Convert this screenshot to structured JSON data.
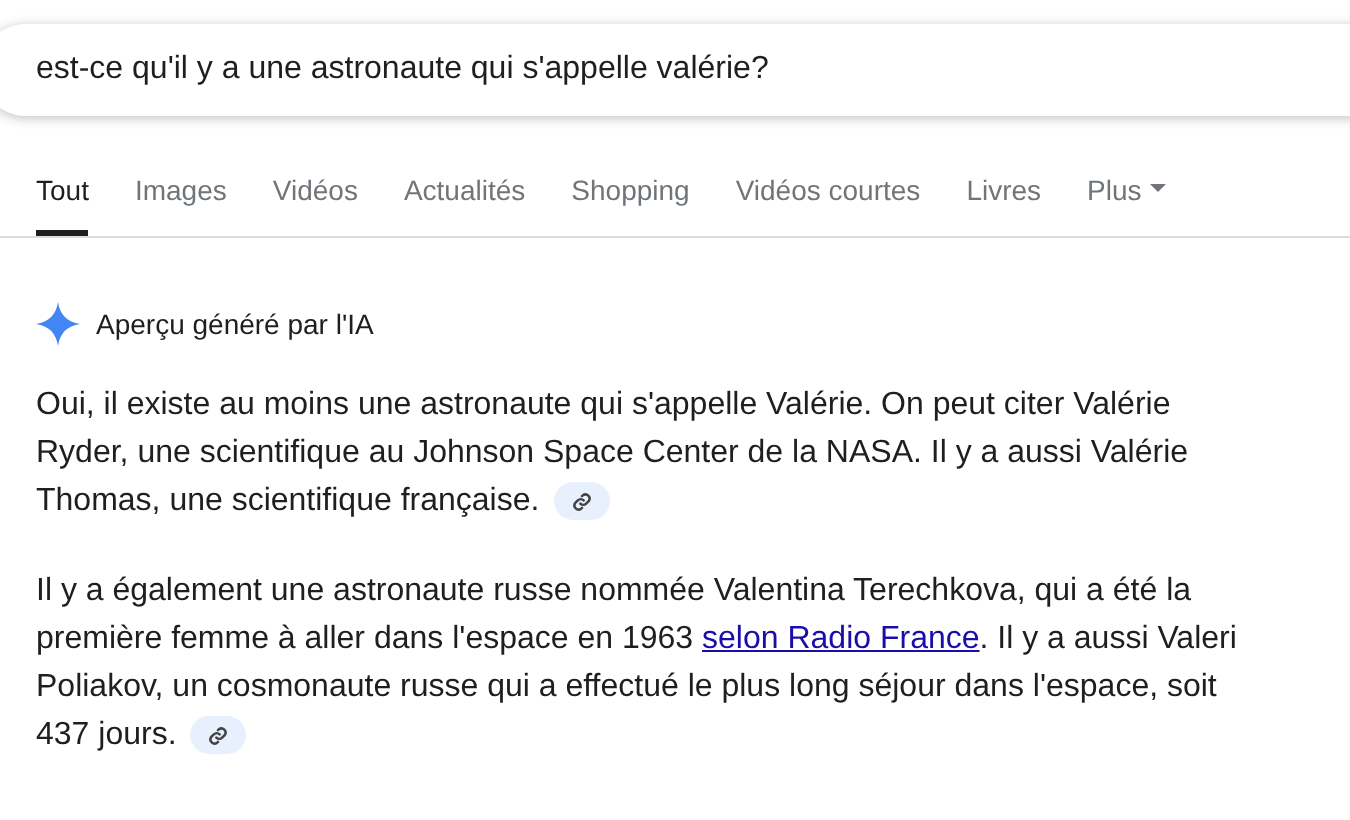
{
  "search": {
    "value": "est-ce qu'il y a une astronaute qui s'appelle valérie?"
  },
  "tabs": [
    {
      "label": "Tout",
      "selected": true
    },
    {
      "label": "Images",
      "selected": false
    },
    {
      "label": "Vidéos",
      "selected": false
    },
    {
      "label": "Actualités",
      "selected": false
    },
    {
      "label": "Shopping",
      "selected": false
    },
    {
      "label": "Vidéos courtes",
      "selected": false
    },
    {
      "label": "Livres",
      "selected": false
    },
    {
      "label": "Plus",
      "selected": false,
      "kind": "menu"
    }
  ],
  "ai_overview": {
    "heading": "Aperçu généré par l'IA",
    "paragraphs": [
      {
        "segments": [
          {
            "kind": "text",
            "text": "Oui, il existe au moins une astronaute qui s'appelle Valérie. On peut citer Valérie Ryder, une scientifique au Johnson Space Center de la NASA. Il y a aussi Valérie Thomas, une scientifique française."
          }
        ],
        "source_chip": true
      },
      {
        "segments": [
          {
            "kind": "text",
            "text": "Il y a également une astronaute russe nommée Valentina Terechkova, qui a été la première femme à aller dans l'espace en 1963 "
          },
          {
            "kind": "link",
            "text": "selon Radio France"
          },
          {
            "kind": "text",
            "text": ". Il y a aussi Valeri Poliakov, un cosmonaute russe qui a effectué le plus long séjour dans l'espace, soit 437 jours."
          }
        ],
        "source_chip": true
      }
    ]
  }
}
